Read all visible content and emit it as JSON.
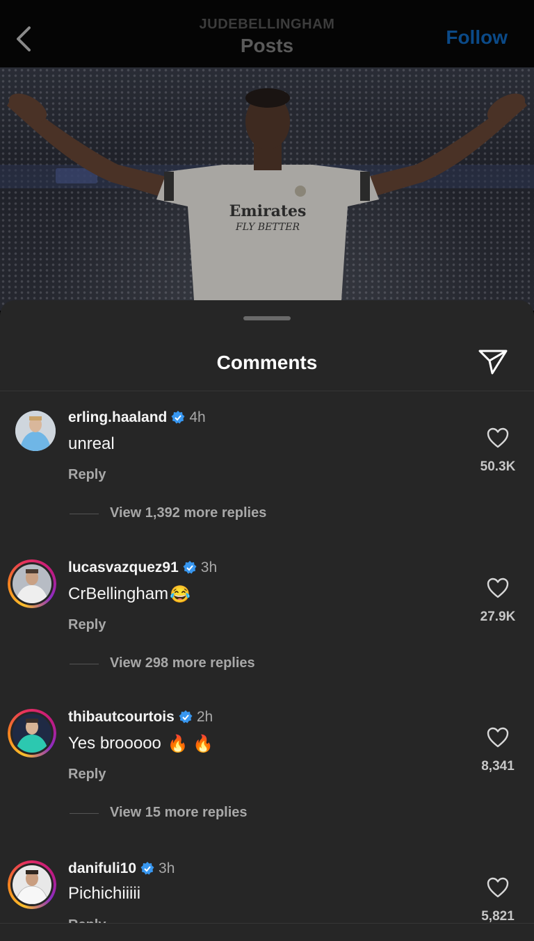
{
  "header": {
    "username": "JUDEBELLINGHAM",
    "title": "Posts",
    "follow_label": "Follow",
    "back_icon": "chevron-left-icon"
  },
  "post": {
    "jersey_sponsor": "Emirates",
    "jersey_tagline": "FLY BETTER"
  },
  "sheet": {
    "title": "Comments",
    "share_icon": "paper-plane-icon"
  },
  "colors": {
    "sheet_bg": "#262626",
    "verified": "#3897f0",
    "follow": "#0b4a88",
    "secondary_text": "#a8a8a8"
  },
  "comments": [
    {
      "username": "erling.haaland",
      "time": "4h",
      "text": "unreal",
      "reply_label": "Reply",
      "likes": "50.3K",
      "view_replies": "View 1,392 more replies",
      "has_story": false
    },
    {
      "username": "lucasvazquez91",
      "time": "3h",
      "text": "CrBellingham",
      "emoji": "😂",
      "reply_label": "Reply",
      "likes": "27.9K",
      "view_replies": "View 298 more replies",
      "has_story": true
    },
    {
      "username": "thibautcourtois",
      "time": "2h",
      "text": "Yes brooooo",
      "emoji": "🔥 🔥",
      "reply_label": "Reply",
      "likes": "8,341",
      "view_replies": "View 15 more replies",
      "has_story": true
    },
    {
      "username": "danifuli10",
      "time": "3h",
      "text": "Pichichiiiii",
      "reply_label": "Reply",
      "likes": "5,821",
      "has_story": true
    }
  ]
}
